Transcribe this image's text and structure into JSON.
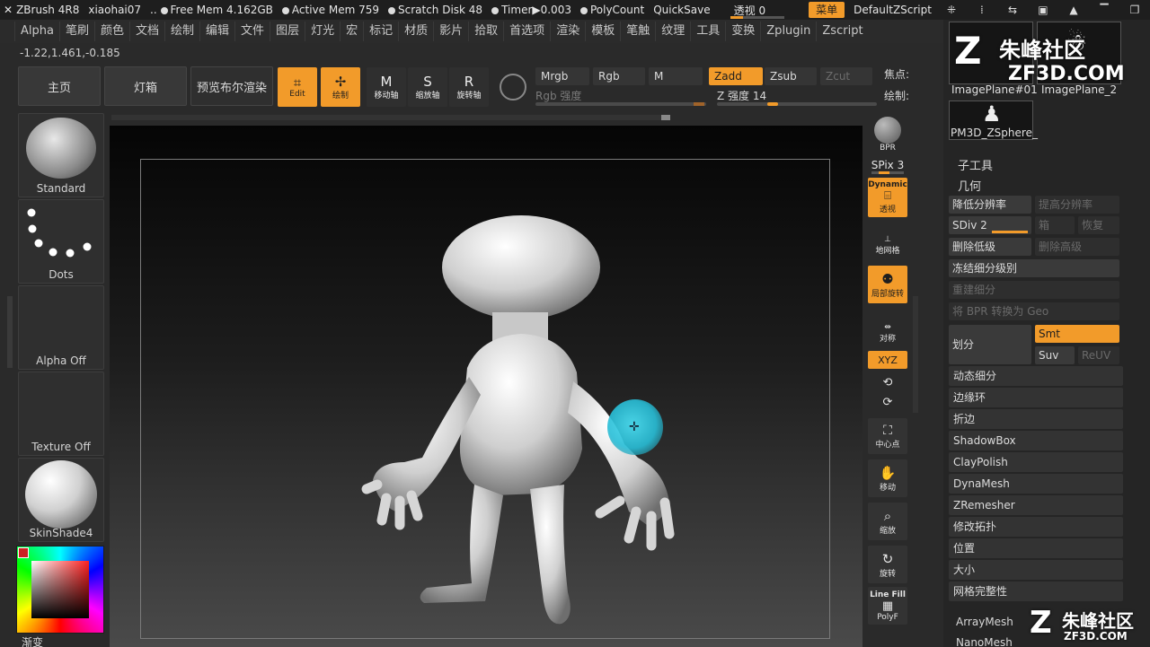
{
  "titlebar": {
    "app": "ZBrush 4R8",
    "user": "xiaohai07",
    "free_mem": "Free Mem 4.162GB",
    "active_mem": "Active Mem 759",
    "scratch_disk": "Scratch Disk 48",
    "timer": "Timer▶0.003",
    "polycount": "PolyCount",
    "quicksave": "QuickSave",
    "perspective": "透视",
    "perspective_value": "0",
    "menu_button": "菜单",
    "script": "DefaultZScript"
  },
  "menubar": [
    "Alpha",
    "笔刷",
    "颜色",
    "文档",
    "绘制",
    "编辑",
    "文件",
    "图层",
    "灯光",
    "宏",
    "标记",
    "材质",
    "影片",
    "拾取",
    "首选项",
    "渲染",
    "模板",
    "笔触",
    "纹理",
    "工具",
    "变换",
    "Zplugin",
    "Zscript"
  ],
  "coords": "-1.22,1.461,-0.185",
  "shelf": {
    "home": "主页",
    "lightbox": "灯箱",
    "bpr_preview": "预览布尔渲染",
    "edit": "Edit",
    "draw": "绘制",
    "move": "移动轴",
    "scale": "缩放轴",
    "rotate": "旋转轴",
    "mrgb": "Mrgb",
    "rgb": "Rgb",
    "m": "M",
    "zadd": "Zadd",
    "zsub": "Zsub",
    "zcut": "Zcut",
    "rgb_intensity": "Rgb 强度",
    "z_intensity": "Z 强度 14",
    "focal": "焦点:",
    "draw_size": "绘制:",
    "z_intensity_value": 14
  },
  "left_shelf": {
    "brush": "Standard",
    "stroke": "Dots",
    "alpha": "Alpha Off",
    "texture": "Texture Off",
    "material": "SkinShade4",
    "gradient": "渐变"
  },
  "right_shelf": {
    "bpr": "BPR",
    "spix": "SPix 3",
    "dynamic": "Dynamic",
    "perspective": "透视",
    "floor": "地网格",
    "local": "局部旋转",
    "sym": "对称",
    "xyz": "XYZ",
    "center": "中心点",
    "move": "移动",
    "zoom": "缩放",
    "rotate": "旋转",
    "linefill": "Line Fill",
    "polyf": "PolyF"
  },
  "palette": {
    "thumb1": "ImagePlane#01",
    "thumb2": "ImagePlane_2",
    "thumb3": "PM3D_ZSphere_",
    "subtool": "子工具",
    "geometry": "几何",
    "lower_res": "降低分辨率",
    "higher_res": "提高分辨率",
    "sdiv": "SDiv 2",
    "cage": "箱",
    "reconstruct": "恢复",
    "del_lower": "删除低级",
    "del_higher": "删除高级",
    "freeze": "冻结细分级别",
    "rebuild": "重建细分",
    "bpr_geo": "将 BPR 转换为 Geo",
    "divide": "划分",
    "smt": "Smt",
    "suv": "Suv",
    "reuv": "ReUV",
    "items": [
      "动态细分",
      "边缘环",
      "折边",
      "ShadowBox",
      "ClayPolish",
      "DynaMesh",
      "ZRemesher",
      "修改拓扑",
      "位置",
      "大小",
      "网格完整性"
    ],
    "arraymesh": "ArrayMesh",
    "nanomesh": "NanoMesh"
  },
  "watermark": {
    "site_name": "朱峰社区",
    "url": "ZF3D.COM"
  },
  "colors": {
    "accent": "#f29b2a",
    "panel": "#2a2a2a",
    "canvas_top": "#050505",
    "brush_cursor": "#3fd3e8"
  }
}
